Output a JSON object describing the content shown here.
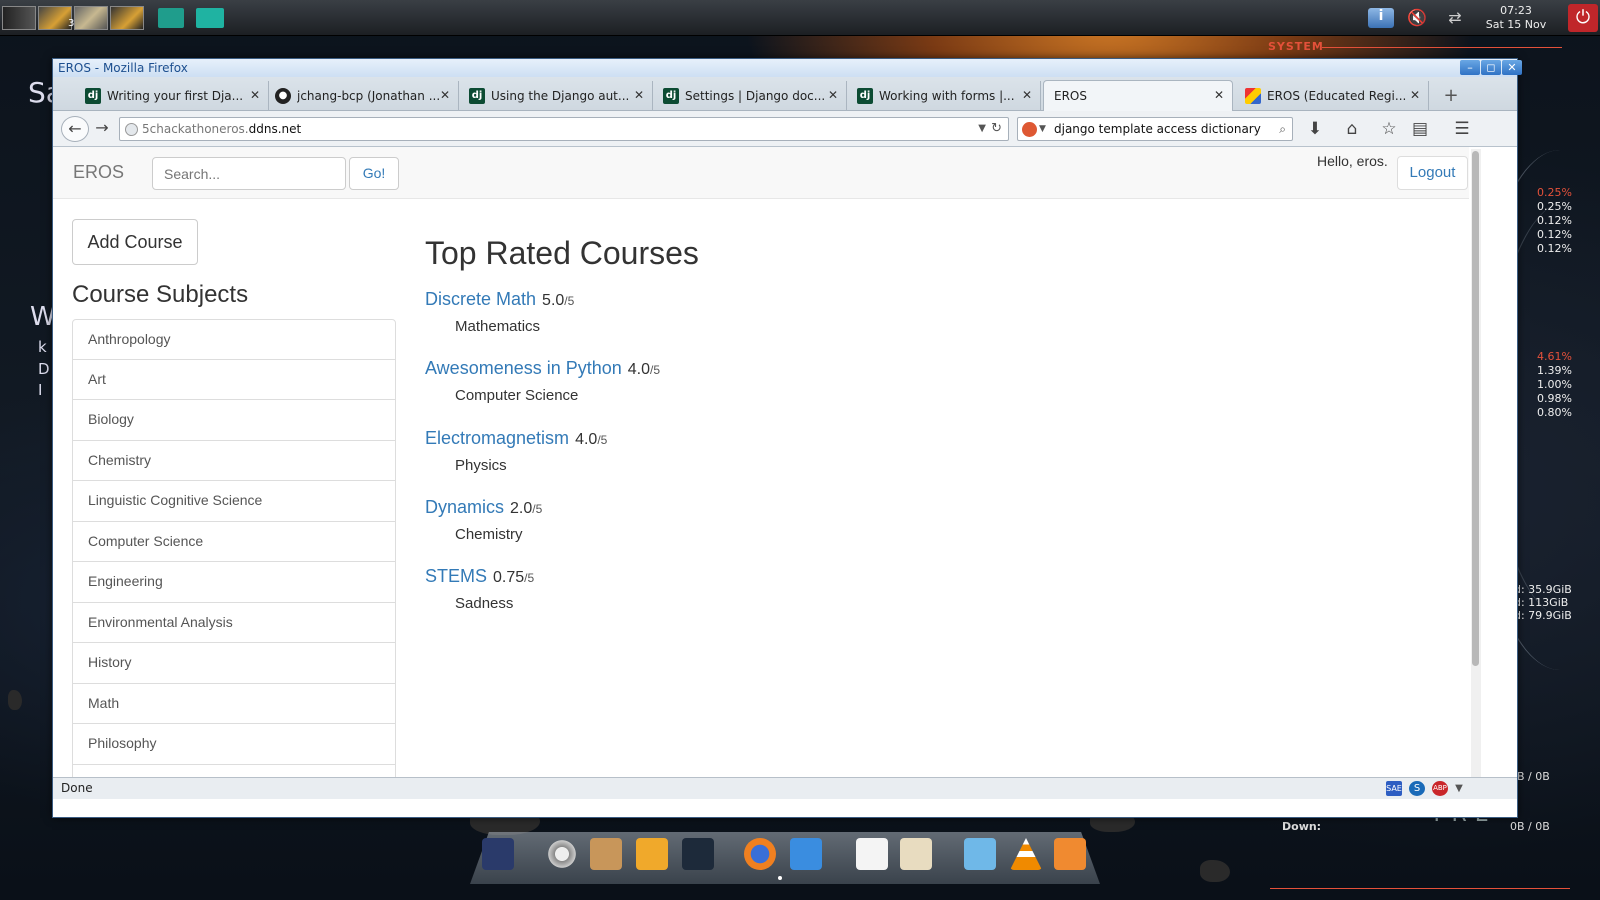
{
  "desktop": {
    "ws_number": "3",
    "clock_time": "07:23",
    "clock_date": "Sat 15 Nov",
    "system_label": "SYSTEM",
    "conky_cpu": [
      "0.25%",
      "0.25%",
      "0.12%",
      "0.12%",
      "0.12%"
    ],
    "conky_mem": [
      "4.61%",
      "1.39%",
      "1.00%",
      "0.98%",
      "0.80%"
    ],
    "conky_disk": [
      "d: 35.9GiB",
      "d: 113GiB",
      "d: 79.9GiB"
    ],
    "net_up": "0B / 0B",
    "net_down_label": "Down:",
    "net_down": "0B / 0B",
    "wallpaper_text": "TRE",
    "left_text_1": "Sa",
    "left_text_2": "W",
    "left_text_3": "k",
    "left_text_4": "D",
    "left_text_5": "I"
  },
  "window": {
    "title": "EROS - Mozilla Firefox",
    "btn_min": "–",
    "btn_max": "◻",
    "btn_close": "✕"
  },
  "tabs": [
    {
      "label": "Writing your first Dja...",
      "favicon": "dj"
    },
    {
      "label": "jchang-bcp (Jonathan ...",
      "favicon": "gh"
    },
    {
      "label": "Using the Django aut...",
      "favicon": "dj"
    },
    {
      "label": "Settings | Django doc...",
      "favicon": "dj"
    },
    {
      "label": "Working with forms |...",
      "favicon": "dj"
    },
    {
      "label": "EROS",
      "favicon": "none",
      "active": true
    },
    {
      "label": "EROS (Educated Regi...",
      "favicon": "eros"
    }
  ],
  "tab_close": "✕",
  "new_tab": "+",
  "nav": {
    "url_prefix": "5chackathoneros.",
    "url_domain": "ddns.net",
    "search_value": "django template access dictionary"
  },
  "site": {
    "brand": "EROS",
    "search_placeholder": "Search...",
    "go_label": "Go!",
    "hello": "Hello, eros.",
    "logout_label": "Logout",
    "add_course_label": "Add Course",
    "subjects_title": "Course Subjects",
    "subjects": [
      "Anthropology",
      "Art",
      "Biology",
      "Chemistry",
      "Linguistic Cognitive Science",
      "Computer Science",
      "Engineering",
      "Environmental Analysis",
      "History",
      "Math",
      "Philosophy"
    ],
    "top_rated_title": "Top Rated Courses",
    "courses": [
      {
        "name": "Discrete Math",
        "rating": "5.0",
        "out_of": "/5",
        "subject": "Mathematics"
      },
      {
        "name": "Awesomeness in Python",
        "rating": "4.0",
        "out_of": "/5",
        "subject": "Computer Science"
      },
      {
        "name": "Electromagnetism",
        "rating": "4.0",
        "out_of": "/5",
        "subject": "Physics"
      },
      {
        "name": "Dynamics",
        "rating": "2.0",
        "out_of": "/5",
        "subject": "Chemistry"
      },
      {
        "name": "STEMS",
        "rating": "0.75",
        "out_of": "/5",
        "subject": "Sadness"
      }
    ]
  },
  "statusbar": {
    "text": "Done"
  },
  "colors": {
    "link": "#337ab7",
    "accent_red": "#e4513a",
    "navbar_bg": "#f8f8f8"
  }
}
